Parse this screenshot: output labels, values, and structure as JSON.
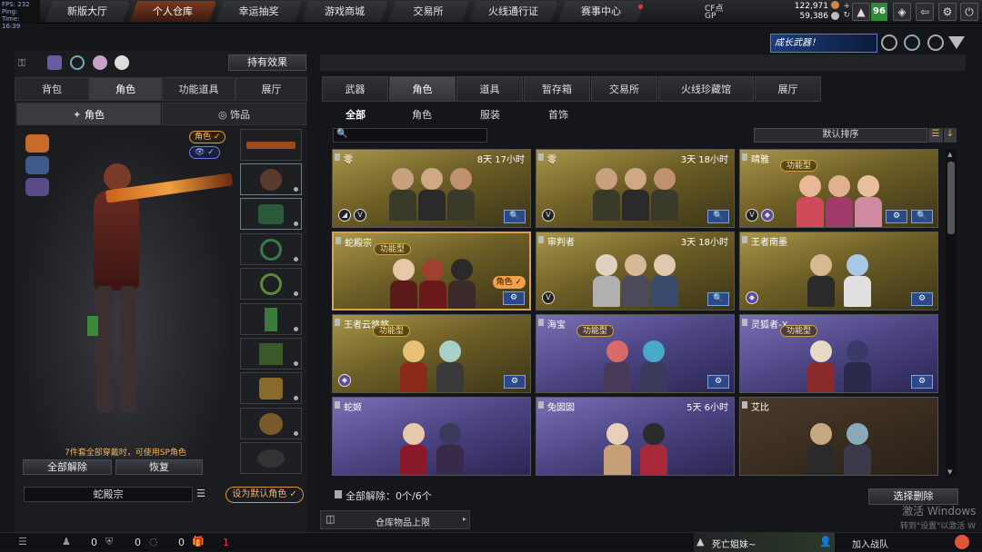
{
  "perf": {
    "fps": "FPS: 232",
    "ping": "Ping:",
    "time": "Time: 16:39"
  },
  "nav": [
    {
      "label": "新版大厅"
    },
    {
      "label": "个人仓库"
    },
    {
      "label": "幸运抽奖"
    },
    {
      "label": "游戏商城"
    },
    {
      "label": "交易所"
    },
    {
      "label": "火线通行证"
    },
    {
      "label": "赛事中心"
    }
  ],
  "currency": {
    "cf_label": "CF点",
    "cf_value": "122,971",
    "gp_label": "GP",
    "gp_value": "59,386"
  },
  "level": "96",
  "banner": "成长武器！",
  "left": {
    "effects_btn": "持有效果",
    "tabs": [
      "背包",
      "角色",
      "功能道具",
      "展厅"
    ],
    "subtabs": [
      "角色",
      "饰品"
    ],
    "role_tag": "角色",
    "eye_tag": "👁",
    "sp_note": "7件套全部穿戴时，可使用SP角色",
    "unequip_all": "全部解除",
    "restore": "恢复",
    "current_name": "蛇殿宗",
    "set_default": "设为默认角色"
  },
  "right": {
    "tabs": [
      "武器",
      "角色",
      "道具",
      "暂存箱",
      "交易所",
      "火线珍藏馆",
      "展厅"
    ],
    "categories": [
      "全部",
      "角色",
      "服装",
      "首饰"
    ],
    "sort_label": "默认排序",
    "search_placeholder": "",
    "func_label": "功能型",
    "role_badge": "角色",
    "cards": [
      {
        "name": "零",
        "time": "8天 17小时",
        "theme": "gold"
      },
      {
        "name": "零",
        "time": "3天 18小时",
        "theme": "gold"
      },
      {
        "name": "晴雅",
        "time": "",
        "theme": "gold"
      },
      {
        "name": "蛇殿宗",
        "time": "",
        "theme": "gold"
      },
      {
        "name": "审判者",
        "time": "3天 18小时",
        "theme": "gold"
      },
      {
        "name": "王者南墨",
        "time": "",
        "theme": "gold"
      },
      {
        "name": "王者云悠悠",
        "time": "",
        "theme": "gold"
      },
      {
        "name": "海宝",
        "time": "",
        "theme": "purple"
      },
      {
        "name": "灵狐者-X",
        "time": "",
        "theme": "purple"
      },
      {
        "name": "蛇姬",
        "time": "",
        "theme": "purple"
      },
      {
        "name": "兔囡囡",
        "time": "5天 6小时",
        "theme": "purple"
      },
      {
        "name": "艾比",
        "time": "",
        "theme": "gold"
      }
    ],
    "unequip_count": "全部解除：0个/6个",
    "select_delete": "选择删除",
    "storage_limit": "仓库物品上限"
  },
  "bottom": {
    "counts": [
      "0",
      "0",
      "0",
      "1"
    ],
    "player": "死亡姐妹~",
    "join_team": "加入战队",
    "watermark1": "激活 Windows",
    "watermark2": "转到\"设置\"以激活 W"
  }
}
